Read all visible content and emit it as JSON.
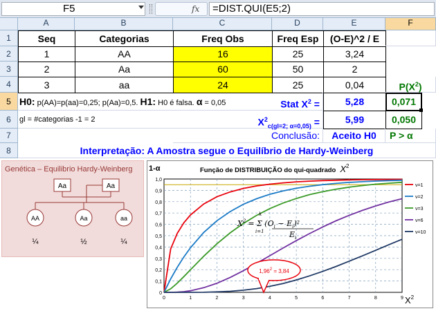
{
  "formula_bar": {
    "name_box": "F5",
    "fx": "fx",
    "formula": "=DIST.QUI(E5;2)"
  },
  "columns": [
    "A",
    "B",
    "C",
    "D",
    "E",
    "F"
  ],
  "rows": [
    "1",
    "2",
    "3",
    "4",
    "5",
    "6",
    "7",
    "8"
  ],
  "table": {
    "headers": [
      "Seq",
      "Categorias",
      "Freq Obs",
      "Freq Esp",
      "(O-E)^2 / E"
    ],
    "rows": [
      [
        "1",
        "AA",
        "16",
        "25",
        "3,24"
      ],
      [
        "2",
        "Aa",
        "60",
        "50",
        "2"
      ],
      [
        "3",
        "aa",
        "24",
        "25",
        "0,04"
      ]
    ],
    "p_label": "P(X",
    "p_label_sup": "2",
    "p_label_end": ")"
  },
  "row5": {
    "h0_label": "H0:",
    "h0_text": "p(AA)=p(aa)=0,25; p(Aa)=0,5.",
    "h1_label": "H1:",
    "h1_text": "H0 é falsa.",
    "alpha_symbol": "α",
    "alpha_value": "= 0,05",
    "stat_label": "Stat X",
    "stat_sup": "2",
    "stat_eq": " =",
    "stat_value": "5,28",
    "p_value": "0,071"
  },
  "row6": {
    "gl_text": "gl = #categorias -1 = 2",
    "crit_label": "X",
    "crit_sup": "2",
    "crit_sub": "c(gl=2; α=0,05)",
    "crit_eq": " =",
    "crit_value": "5,99",
    "alpha_cell": "0,050"
  },
  "row7": {
    "conclusion_label": "Conclusão:",
    "conclusion_value": "Aceito H0",
    "p_compare": "P > α"
  },
  "row8": {
    "interpretation": "Interpretação: A Amostra segue o Equilíbrio de Hardy-Weinberg"
  },
  "genetics": {
    "title": "Genética – Equilibrio Hardy-Weinberg",
    "parent1": "Aa",
    "parent2": "Aa",
    "offspring": [
      "AA",
      "Aa",
      "aa"
    ],
    "fractions": [
      "¼",
      "½",
      "¼"
    ]
  },
  "chart_data": {
    "type": "line",
    "title": "Função de DISTRIBUIÇÃO do qui-quadrado",
    "title_symbol": "X",
    "title_sup": "2",
    "ylabel": "1-α",
    "xlabel": "X",
    "xlabel_sup": "2",
    "xlim": [
      0,
      9
    ],
    "ylim": [
      0,
      1
    ],
    "x_ticks": [
      "0",
      "1",
      "2",
      "3",
      "4",
      "5",
      "6",
      "7",
      "8",
      "9"
    ],
    "y_ticks": [
      "0",
      "0,1",
      "0,2",
      "0,3",
      "0,4",
      "0,5",
      "0,6",
      "0,7",
      "0,8",
      "0,9",
      "1,0"
    ],
    "grid": true,
    "legend_position": "right",
    "x": [
      0,
      0.25,
      0.5,
      0.75,
      1,
      1.5,
      2,
      2.5,
      3,
      3.5,
      4,
      4.5,
      5,
      5.5,
      6,
      6.5,
      7,
      7.5,
      8,
      8.5,
      9
    ],
    "series": [
      {
        "name": "ν=1",
        "color": "#e8000b",
        "values": [
          0,
          0.383,
          0.52,
          0.614,
          0.683,
          0.779,
          0.843,
          0.886,
          0.917,
          0.939,
          0.954,
          0.966,
          0.975,
          0.981,
          0.986,
          0.989,
          0.992,
          0.994,
          0.995,
          0.996,
          0.997
        ]
      },
      {
        "name": "ν=2",
        "color": "#1a7ac6",
        "values": [
          0,
          0.118,
          0.221,
          0.313,
          0.393,
          0.528,
          0.632,
          0.713,
          0.777,
          0.826,
          0.865,
          0.895,
          0.918,
          0.936,
          0.95,
          0.961,
          0.97,
          0.976,
          0.982,
          0.986,
          0.989
        ]
      },
      {
        "name": "ν=3",
        "color": "#3a9a27",
        "values": [
          0,
          0.031,
          0.081,
          0.139,
          0.199,
          0.318,
          0.428,
          0.525,
          0.608,
          0.679,
          0.739,
          0.788,
          0.828,
          0.862,
          0.888,
          0.91,
          0.928,
          0.942,
          0.954,
          0.963,
          0.971
        ]
      },
      {
        "name": "ν=6",
        "color": "#7030a0",
        "values": [
          0,
          0.0,
          0.002,
          0.006,
          0.014,
          0.041,
          0.08,
          0.132,
          0.191,
          0.256,
          0.323,
          0.391,
          0.456,
          0.518,
          0.577,
          0.631,
          0.679,
          0.723,
          0.762,
          0.797,
          0.826
        ]
      },
      {
        "name": "ν=10",
        "color": "#1f3864",
        "values": [
          0,
          0,
          0,
          0,
          0.0002,
          0.0008,
          0.004,
          0.009,
          0.019,
          0.033,
          0.053,
          0.078,
          0.109,
          0.145,
          0.185,
          0.228,
          0.275,
          0.322,
          0.371,
          0.42,
          0.468
        ]
      }
    ],
    "reference_line": {
      "y": 0.95,
      "color": "#c9a800"
    },
    "formula_label": "X",
    "formula_sup": "2",
    "formula_rhs": "= Σ (O",
    "formula_sub_i": "i",
    "formula_minus": " − E",
    "formula_close": ")²",
    "formula_den": "E",
    "formula_sum_top": "k",
    "formula_sum_bot": "i=1",
    "callout": "1,96",
    "callout_sup": "2",
    "callout_rest": " = 3,84",
    "callout_color": "#e8000b"
  }
}
